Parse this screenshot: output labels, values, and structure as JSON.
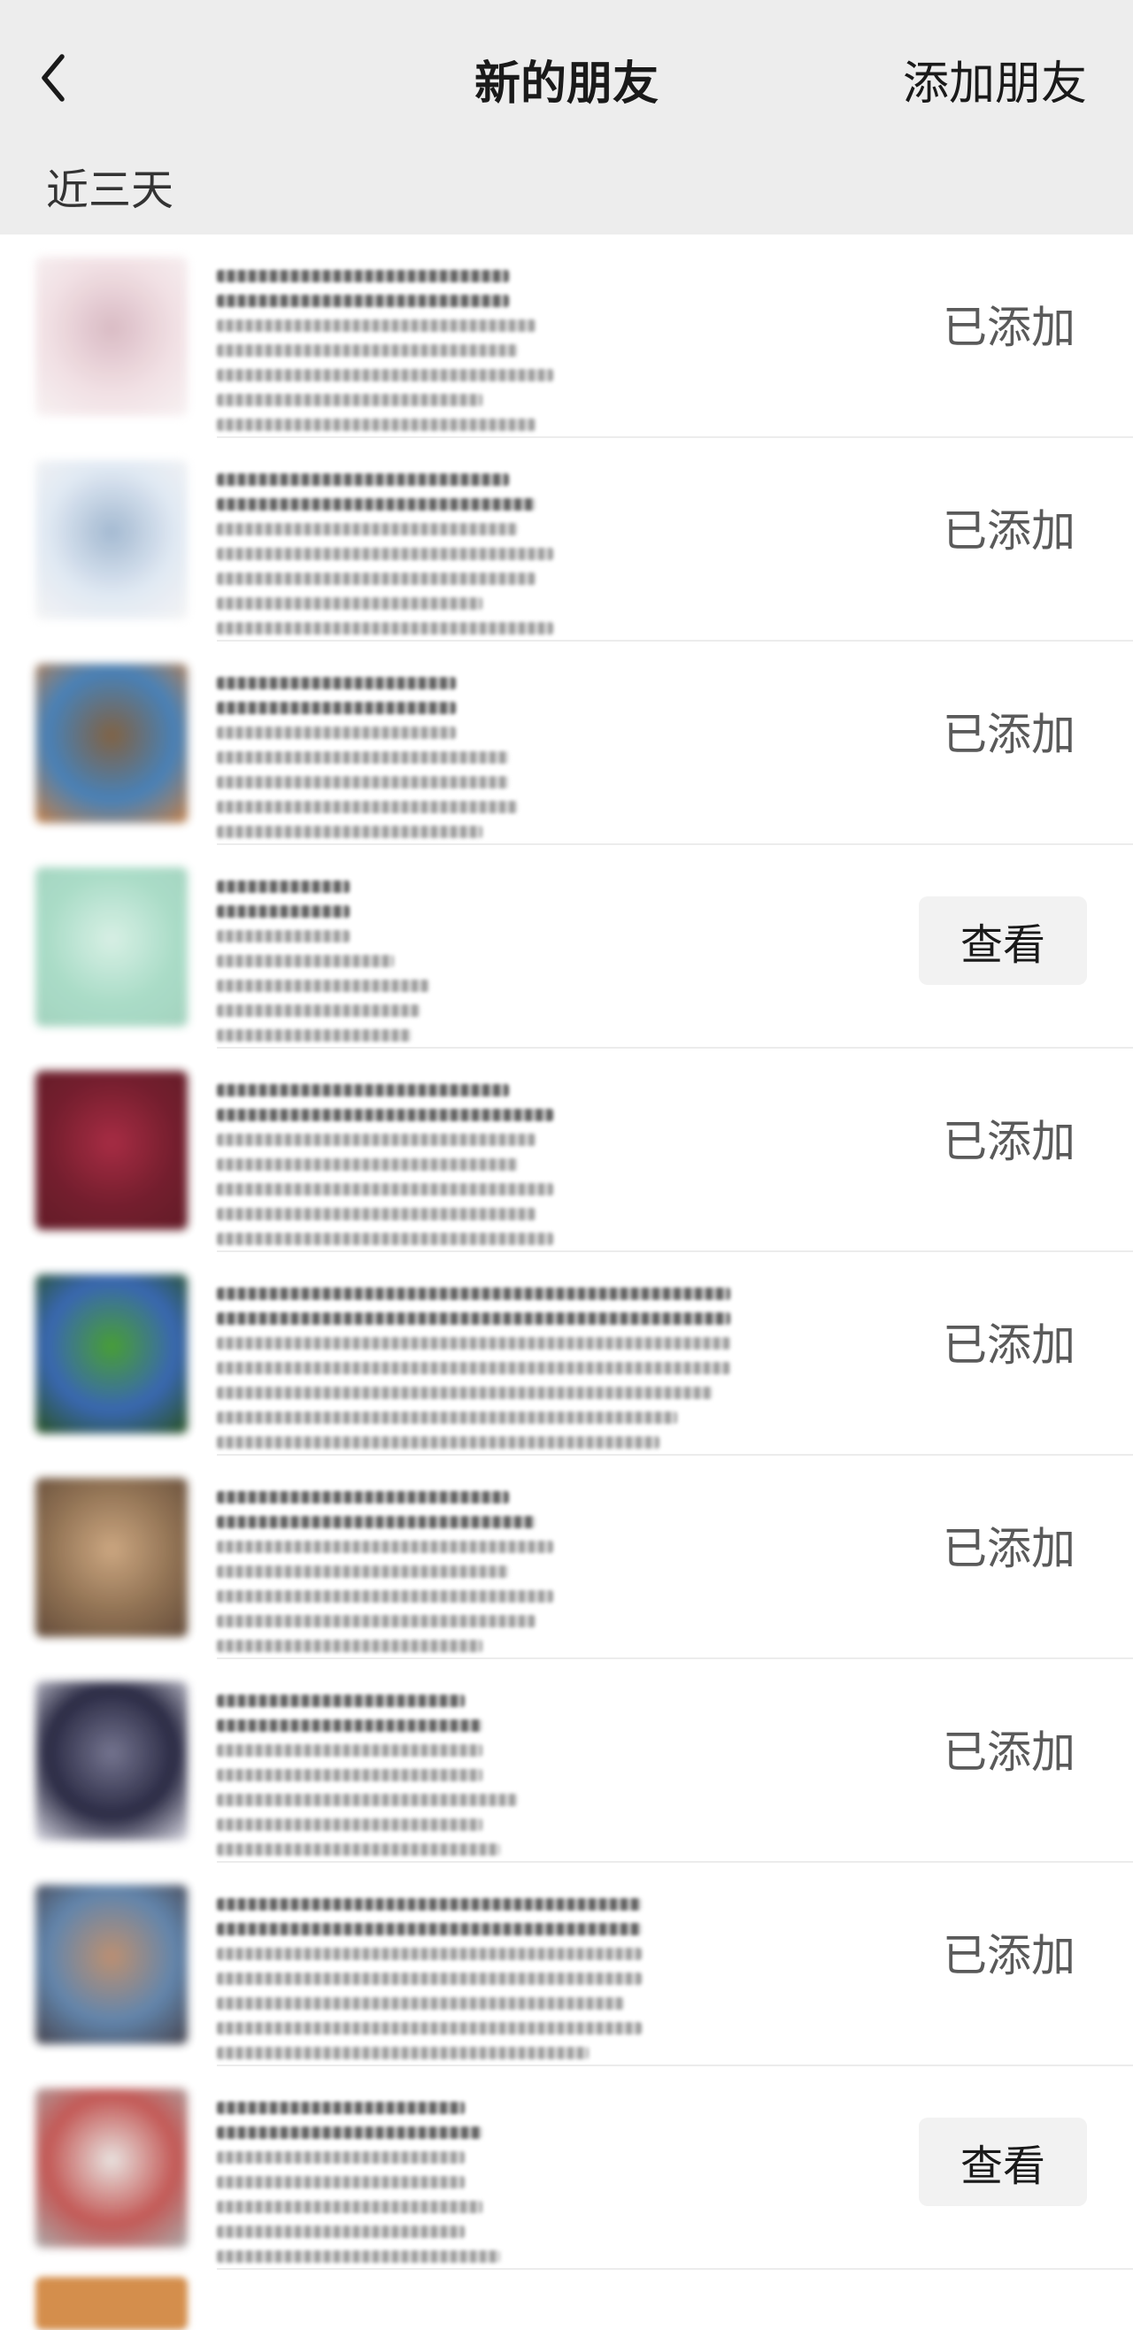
{
  "header": {
    "title": "新的朋友",
    "add_friend_label": "添加朋友",
    "back_icon": "chevron-left-icon"
  },
  "section": {
    "label": "近三天"
  },
  "colors": {
    "header_bg": "#ededed",
    "list_bg": "#ffffff",
    "view_button_bg": "#f2f2f2",
    "status_text": "#5a5a5a"
  },
  "friends": [
    {
      "status_type": "added",
      "status_label": "已添加",
      "avatar_colors": [
        "#f1dfe3",
        "#d8b8c2",
        "#f7f1f2"
      ]
    },
    {
      "status_type": "added",
      "status_label": "已添加",
      "avatar_colors": [
        "#dfe8f3",
        "#9fb6cf",
        "#f4f4f4"
      ]
    },
    {
      "status_type": "added",
      "status_label": "已添加",
      "avatar_colors": [
        "#3f7bb4",
        "#7a5a3a",
        "#c47a3d"
      ]
    },
    {
      "status_type": "view",
      "status_label": "查看",
      "avatar_colors": [
        "#a6dbc5",
        "#d6efe4",
        "#9fd0bb"
      ]
    },
    {
      "status_type": "added",
      "status_label": "已添加",
      "avatar_colors": [
        "#6d1323",
        "#a3213a",
        "#5a0f1c"
      ]
    },
    {
      "status_type": "added",
      "status_label": "已添加",
      "avatar_colors": [
        "#2f5fae",
        "#3f9a2a",
        "#1e4a14"
      ]
    },
    {
      "status_type": "added",
      "status_label": "已添加",
      "avatar_colors": [
        "#8a6a4a",
        "#c9a27a",
        "#5b4230"
      ]
    },
    {
      "status_type": "added",
      "status_label": "已添加",
      "avatar_colors": [
        "#1f1f3a",
        "#6e6e8a",
        "#dcdce6"
      ]
    },
    {
      "status_type": "added",
      "status_label": "已添加",
      "avatar_colors": [
        "#5a7fa8",
        "#b98a6a",
        "#3d3a44"
      ]
    },
    {
      "status_type": "view",
      "status_label": "查看",
      "avatar_colors": [
        "#c0504d",
        "#e8e2df",
        "#a8a8a8"
      ]
    }
  ]
}
